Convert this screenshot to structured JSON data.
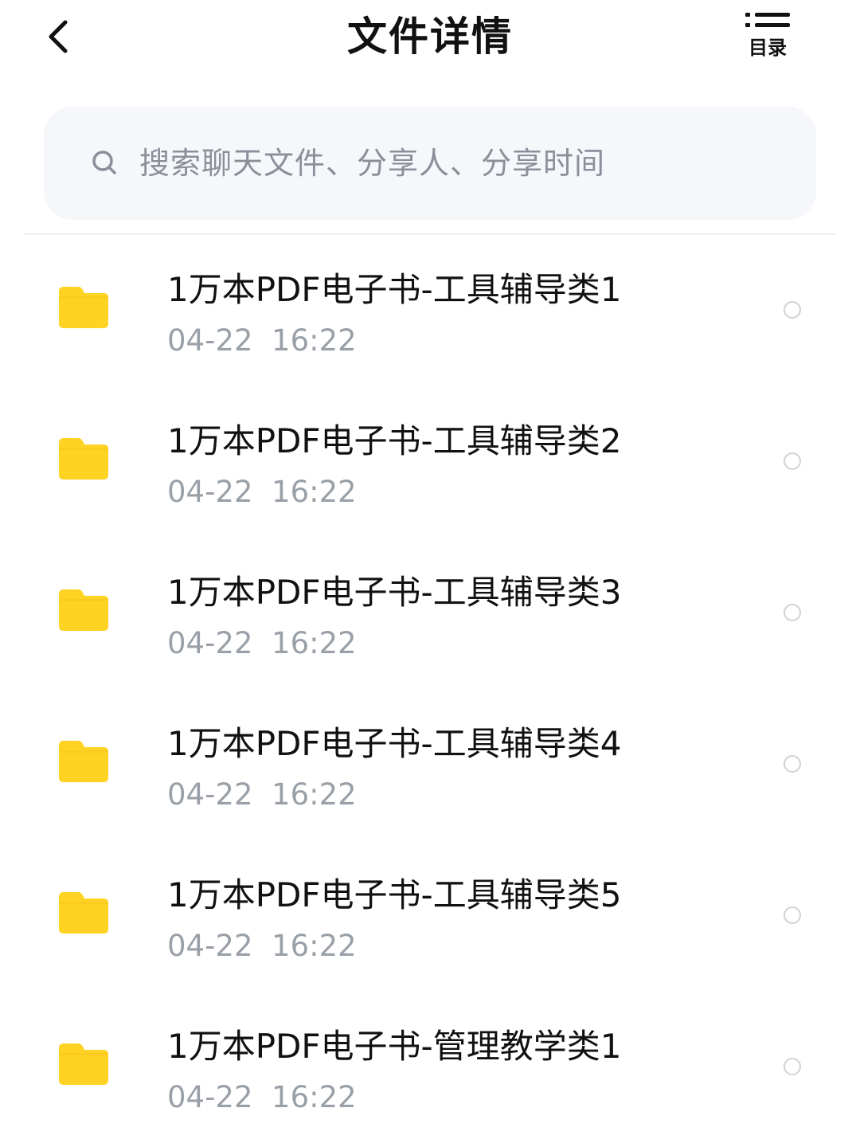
{
  "header": {
    "title": "文件详情",
    "toc_label": "目录"
  },
  "search": {
    "placeholder": "搜索聊天文件、分享人、分享时间"
  },
  "colors": {
    "folder": "#FFD324",
    "folder_tab": "#F8C81C",
    "placeholder": "#8A8F99",
    "time": "#9AA0A8",
    "search_bg": "#F5F7FA"
  },
  "files": [
    {
      "name": "1万本PDF电子书-工具辅导类1",
      "time": "04-22  16:22",
      "icon": "folder-icon"
    },
    {
      "name": "1万本PDF电子书-工具辅导类2",
      "time": "04-22  16:22",
      "icon": "folder-icon"
    },
    {
      "name": "1万本PDF电子书-工具辅导类3",
      "time": "04-22  16:22",
      "icon": "folder-icon"
    },
    {
      "name": "1万本PDF电子书-工具辅导类4",
      "time": "04-22  16:22",
      "icon": "folder-icon"
    },
    {
      "name": "1万本PDF电子书-工具辅导类5",
      "time": "04-22  16:22",
      "icon": "folder-icon"
    },
    {
      "name": "1万本PDF电子书-管理教学类1",
      "time": "04-22  16:22",
      "icon": "folder-icon"
    }
  ]
}
